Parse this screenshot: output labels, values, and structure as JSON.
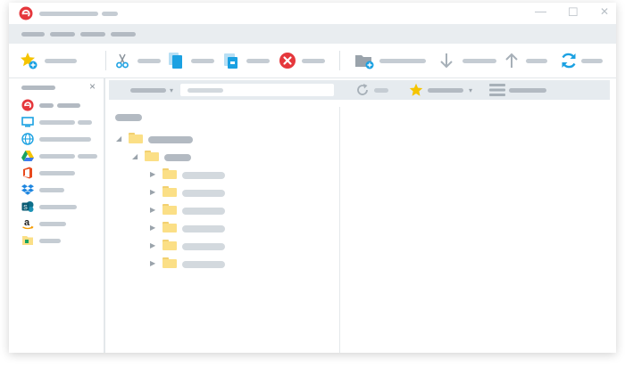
{
  "window": {
    "controls": {
      "minimize": "—",
      "maximize": "☐",
      "close": "✕"
    }
  },
  "toolbar": {
    "favorite_icon": "star-add-icon",
    "cut_icon": "scissors-icon",
    "copy_icon": "copy-icon",
    "paste_icon": "paste-icon",
    "delete_icon": "delete-icon",
    "new_folder_icon": "folder-add-icon",
    "download_icon": "arrow-down-icon",
    "upload_icon": "arrow-up-icon",
    "sync_icon": "sync-icon"
  },
  "sidebar": {
    "close": "×",
    "items": [
      {
        "icon": "app-logo-icon"
      },
      {
        "icon": "monitor-icon"
      },
      {
        "icon": "globe-icon"
      },
      {
        "icon": "google-drive-icon"
      },
      {
        "icon": "office-icon"
      },
      {
        "icon": "dropbox-icon"
      },
      {
        "icon": "sharepoint-icon"
      },
      {
        "icon": "amazon-icon"
      },
      {
        "icon": "folder-icon"
      }
    ]
  },
  "subbar": {
    "dropdown_arrow": "▾",
    "fav_arrow": "▾"
  },
  "tree": {
    "expanded": "◢",
    "collapsed": "▶"
  },
  "colors": {
    "accent": "#1ba1e2",
    "delete": "#e5373c",
    "star": "#f5c400",
    "folder": "#fbdf86",
    "placeholder": "#c5ccd3",
    "menubar": "#e9edf0"
  }
}
